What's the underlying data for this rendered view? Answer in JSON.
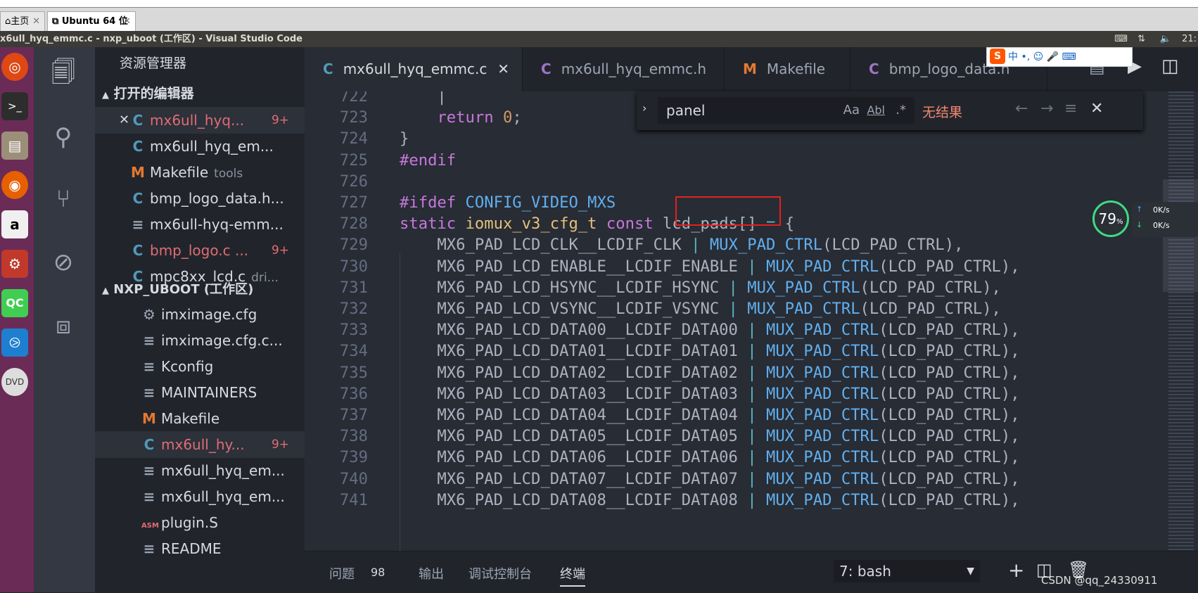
{
  "vm_tabs": {
    "home": "主页",
    "ubuntu": "Ubuntu 64 位"
  },
  "window_title": "x6ull_hyq_emmc.c - nxp_uboot (工作区) - Visual Studio Code",
  "tray": {
    "time": "21:"
  },
  "ime": {
    "label": "中 •, ☺ 🎤 ⌨"
  },
  "sidebar": {
    "explorer_title": "资源管理器",
    "open_editors_title": "打开的编辑器",
    "open_editors": [
      {
        "icon": "C",
        "name": "mx6ull_hyq...",
        "badge": "9+",
        "error": true,
        "close": "✕"
      },
      {
        "icon": "C",
        "name": "mx6ull_hyq_em..."
      },
      {
        "icon": "M",
        "name": "Makefile",
        "sub": "tools"
      },
      {
        "icon": "C",
        "name": "bmp_logo_data.h..."
      },
      {
        "icon": "≡",
        "name": "mx6ull-hyq-emm..."
      },
      {
        "icon": "C",
        "name": "bmp_logo.c ...",
        "badge": "9+",
        "error": true
      },
      {
        "icon": "C",
        "name": "mpc8xx_lcd.c",
        "sub": "dri..."
      }
    ],
    "workspace_title": "NXP_UBOOT (工作区)",
    "files": [
      {
        "icon": "⚙",
        "name": "imximage.cfg"
      },
      {
        "icon": "≡",
        "name": "imximage.cfg.c..."
      },
      {
        "icon": "≡",
        "name": "Kconfig"
      },
      {
        "icon": "≡",
        "name": "MAINTAINERS"
      },
      {
        "icon": "M",
        "name": "Makefile"
      },
      {
        "icon": "C",
        "name": "mx6ull_hy...",
        "badge": "9+",
        "error": true
      },
      {
        "icon": "≡",
        "name": "mx6ull_hyq_em..."
      },
      {
        "icon": "≡",
        "name": "mx6ull_hyq_em..."
      },
      {
        "icon": "ASM",
        "name": "plugin.S"
      },
      {
        "icon": "≡",
        "name": "README"
      }
    ]
  },
  "tabs": [
    {
      "icon": "C",
      "label": "mx6ull_hyq_emmc.c",
      "close": "✕"
    },
    {
      "icon": "C",
      "label": "mx6ull_hyq_emmc.h"
    },
    {
      "icon": "M",
      "label": "Makefile"
    },
    {
      "icon": "C",
      "label": "bmp_logo_data.h"
    }
  ],
  "find": {
    "query": "panel",
    "case": "Aa",
    "word": "Abl",
    "regex": ".*",
    "result": "无结果"
  },
  "code": {
    "lines": [
      {
        "n": "722",
        "text": "    |"
      },
      {
        "n": "723",
        "text": "    return 0;"
      },
      {
        "n": "724",
        "text": "}"
      },
      {
        "n": "725",
        "text": "#endif"
      },
      {
        "n": "726",
        "text": ""
      },
      {
        "n": "727",
        "text": "#ifdef CONFIG_VIDEO_MXS"
      },
      {
        "n": "728",
        "text": "static iomux_v3_cfg_t const lcd_pads[] = {"
      },
      {
        "n": "729",
        "text": "    MX6_PAD_LCD_CLK__LCDIF_CLK | MUX_PAD_CTRL(LCD_PAD_CTRL),"
      },
      {
        "n": "730",
        "text": "    MX6_PAD_LCD_ENABLE__LCDIF_ENABLE | MUX_PAD_CTRL(LCD_PAD_CTRL),"
      },
      {
        "n": "731",
        "text": "    MX6_PAD_LCD_HSYNC__LCDIF_HSYNC | MUX_PAD_CTRL(LCD_PAD_CTRL),"
      },
      {
        "n": "732",
        "text": "    MX6_PAD_LCD_VSYNC__LCDIF_VSYNC | MUX_PAD_CTRL(LCD_PAD_CTRL),"
      },
      {
        "n": "733",
        "text": "    MX6_PAD_LCD_DATA00__LCDIF_DATA00 | MUX_PAD_CTRL(LCD_PAD_CTRL),"
      },
      {
        "n": "734",
        "text": "    MX6_PAD_LCD_DATA01__LCDIF_DATA01 | MUX_PAD_CTRL(LCD_PAD_CTRL),"
      },
      {
        "n": "735",
        "text": "    MX6_PAD_LCD_DATA02__LCDIF_DATA02 | MUX_PAD_CTRL(LCD_PAD_CTRL),"
      },
      {
        "n": "736",
        "text": "    MX6_PAD_LCD_DATA03__LCDIF_DATA03 | MUX_PAD_CTRL(LCD_PAD_CTRL),"
      },
      {
        "n": "737",
        "text": "    MX6_PAD_LCD_DATA04__LCDIF_DATA04 | MUX_PAD_CTRL(LCD_PAD_CTRL),"
      },
      {
        "n": "738",
        "text": "    MX6_PAD_LCD_DATA05__LCDIF_DATA05 | MUX_PAD_CTRL(LCD_PAD_CTRL),"
      },
      {
        "n": "739",
        "text": "    MX6_PAD_LCD_DATA06__LCDIF_DATA06 | MUX_PAD_CTRL(LCD_PAD_CTRL),"
      },
      {
        "n": "740",
        "text": "    MX6_PAD_LCD_DATA07__LCDIF_DATA07 | MUX_PAD_CTRL(LCD_PAD_CTRL),"
      },
      {
        "n": "741",
        "text": "    MX6_PAD_LCD_DATA08__LCDIF_DATA08 | MUX_PAD_CTRL(LCD_PAD_CTRL),"
      }
    ]
  },
  "speed_widget": {
    "percent": "79",
    "percent_sign": "%",
    "up": "0K/s",
    "down": "0K/s"
  },
  "panel": {
    "tabs": [
      "问题",
      "输出",
      "调试控制台",
      "终端"
    ],
    "problems_count": "98",
    "terminal_select": "7: bash",
    "watermark": "CSDN @qq_24330911"
  },
  "colors": {
    "accent": "#528bff",
    "error": "#e06c75",
    "c_icon": "#519aba",
    "makefile_icon": "#e37933",
    "launcher": "#6b2b57"
  }
}
